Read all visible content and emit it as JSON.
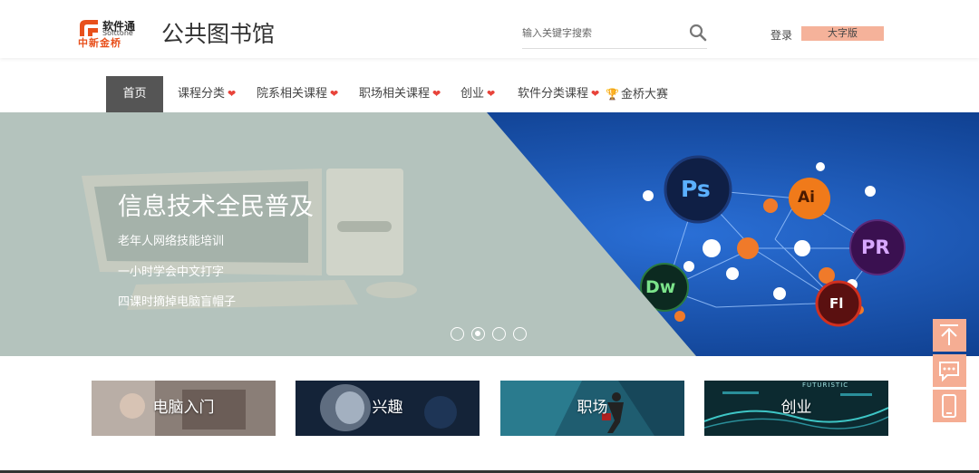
{
  "header": {
    "logo": {
      "cn_top": "软件通",
      "en": "Softtone",
      "cn_bottom": "中新金桥",
      "brand_color": "#e8501c"
    },
    "site_title": "公共图书馆",
    "search": {
      "placeholder": "输入关键字搜索",
      "icon": "search-icon"
    },
    "login": "登录",
    "large_font": "大字版"
  },
  "nav": {
    "items": [
      {
        "label": "首页",
        "active": true
      },
      {
        "label": "课程分类",
        "dropdown": true
      },
      {
        "label": "院系相关课程",
        "dropdown": true
      },
      {
        "label": "职场相关课程",
        "dropdown": true
      },
      {
        "label": "创业",
        "dropdown": true
      },
      {
        "label": "软件分类课程",
        "dropdown": true
      },
      {
        "label": "金桥大赛",
        "icon": "trophy-icon"
      }
    ]
  },
  "banner": {
    "title": "信息技术全民普及",
    "lines": [
      "老年人网络技能培训",
      "一小时学会中文打字",
      "四课时摘掉电脑盲帽子"
    ],
    "slide_count": 4,
    "active_slide": 2,
    "icon_labels": [
      "Ps",
      "Ai",
      "PR",
      "Dw",
      "Fl"
    ]
  },
  "categories": [
    {
      "label": "电脑入门"
    },
    {
      "label": "兴趣"
    },
    {
      "label": "职场"
    },
    {
      "label": "创业",
      "caption": "FUTURISTIC"
    }
  ],
  "float_tools": [
    "back-to-top-icon",
    "message-icon",
    "mobile-icon"
  ],
  "colors": {
    "accent": "#f5ad93",
    "nav_active": "#555555",
    "chevron": "#e8433a"
  }
}
